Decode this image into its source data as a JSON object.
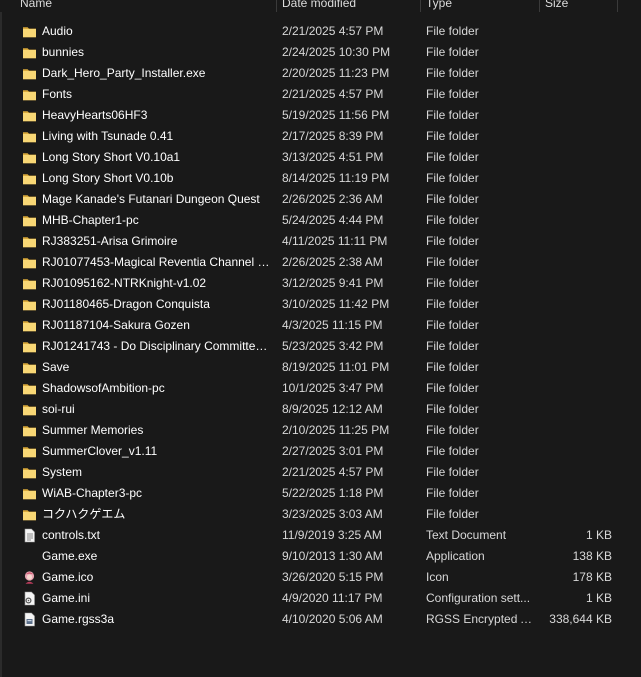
{
  "columns": {
    "name": "Name",
    "date": "Date modified",
    "type": "Type",
    "size": "Size"
  },
  "colors": {
    "background": "#191919",
    "folder": "#f8d775",
    "text": "#ffffff"
  },
  "files": [
    {
      "name": "Audio",
      "date": "2/21/2025 4:57 PM",
      "type": "File folder",
      "size": "",
      "icon": "folder-icon"
    },
    {
      "name": "bunnies",
      "date": "2/24/2025 10:30 PM",
      "type": "File folder",
      "size": "",
      "icon": "folder-icon"
    },
    {
      "name": "Dark_Hero_Party_Installer.exe",
      "date": "2/20/2025 11:23 PM",
      "type": "File folder",
      "size": "",
      "icon": "folder-icon"
    },
    {
      "name": "Fonts",
      "date": "2/21/2025 4:57 PM",
      "type": "File folder",
      "size": "",
      "icon": "folder-icon"
    },
    {
      "name": "HeavyHearts06HF3",
      "date": "5/19/2025 11:56 PM",
      "type": "File folder",
      "size": "",
      "icon": "folder-icon"
    },
    {
      "name": "Living with Tsunade 0.41",
      "date": "2/17/2025 8:39 PM",
      "type": "File folder",
      "size": "",
      "icon": "folder-icon"
    },
    {
      "name": "Long Story Short V0.10a1",
      "date": "3/13/2025 4:51 PM",
      "type": "File folder",
      "size": "",
      "icon": "folder-icon"
    },
    {
      "name": "Long Story Short V0.10b",
      "date": "8/14/2025 11:19 PM",
      "type": "File folder",
      "size": "",
      "icon": "folder-icon"
    },
    {
      "name": "Mage Kanade's Futanari Dungeon Quest",
      "date": "2/26/2025 2:36 AM",
      "type": "File folder",
      "size": "",
      "icon": "folder-icon"
    },
    {
      "name": "MHB-Chapter1-pc",
      "date": "5/24/2025 4:44 PM",
      "type": "File folder",
      "size": "",
      "icon": "folder-icon"
    },
    {
      "name": "RJ383251-Arisa Grimoire",
      "date": "4/11/2025 11:11 PM",
      "type": "File folder",
      "size": "",
      "icon": "folder-icon"
    },
    {
      "name": "RJ01077453-Magical Reventia Channel 1....",
      "date": "2/26/2025 2:38 AM",
      "type": "File folder",
      "size": "",
      "icon": "folder-icon"
    },
    {
      "name": "RJ01095162-NTRKnight-v1.02",
      "date": "3/12/2025 9:41 PM",
      "type": "File folder",
      "size": "",
      "icon": "folder-icon"
    },
    {
      "name": "RJ01180465-Dragon Conquista",
      "date": "3/10/2025 11:42 PM",
      "type": "File folder",
      "size": "",
      "icon": "folder-icon"
    },
    {
      "name": "RJ01187104-Sakura Gozen",
      "date": "4/3/2025 11:15 PM",
      "type": "File folder",
      "size": "",
      "icon": "folder-icon"
    },
    {
      "name": "RJ01241743 - Do Disciplinary Committee ...",
      "date": "5/23/2025 3:42 PM",
      "type": "File folder",
      "size": "",
      "icon": "folder-icon"
    },
    {
      "name": "Save",
      "date": "8/19/2025 11:01 PM",
      "type": "File folder",
      "size": "",
      "icon": "folder-icon"
    },
    {
      "name": "ShadowsofAmbition-pc",
      "date": "10/1/2025 3:47 PM",
      "type": "File folder",
      "size": "",
      "icon": "folder-icon"
    },
    {
      "name": "soi-rui",
      "date": "8/9/2025 12:12 AM",
      "type": "File folder",
      "size": "",
      "icon": "folder-icon"
    },
    {
      "name": "Summer Memories",
      "date": "2/10/2025 11:25 PM",
      "type": "File folder",
      "size": "",
      "icon": "folder-icon"
    },
    {
      "name": "SummerClover_v1.11",
      "date": "2/27/2025 3:01 PM",
      "type": "File folder",
      "size": "",
      "icon": "folder-icon"
    },
    {
      "name": "System",
      "date": "2/21/2025 4:57 PM",
      "type": "File folder",
      "size": "",
      "icon": "folder-icon"
    },
    {
      "name": "WiAB-Chapter3-pc",
      "date": "5/22/2025 1:18 PM",
      "type": "File folder",
      "size": "",
      "icon": "folder-icon"
    },
    {
      "name": "コクハクゲエム",
      "date": "3/23/2025 3:03 AM",
      "type": "File folder",
      "size": "",
      "icon": "folder-icon"
    },
    {
      "name": "controls.txt",
      "date": "11/9/2019 3:25 AM",
      "type": "Text Document",
      "size": "1 KB",
      "icon": "text-document-icon"
    },
    {
      "name": "Game.exe",
      "date": "9/10/2013 1:30 AM",
      "type": "Application",
      "size": "138 KB",
      "icon": "application-icon"
    },
    {
      "name": "Game.ico",
      "date": "3/26/2020 5:15 PM",
      "type": "Icon",
      "size": "178 KB",
      "icon": "character-icon"
    },
    {
      "name": "Game.ini",
      "date": "4/9/2020 11:17 PM",
      "type": "Configuration sett...",
      "size": "1 KB",
      "icon": "config-file-icon"
    },
    {
      "name": "Game.rgss3a",
      "date": "4/10/2020 5:06 AM",
      "type": "RGSS Encrypted A...",
      "size": "338,644 KB",
      "icon": "archive-file-icon"
    }
  ]
}
